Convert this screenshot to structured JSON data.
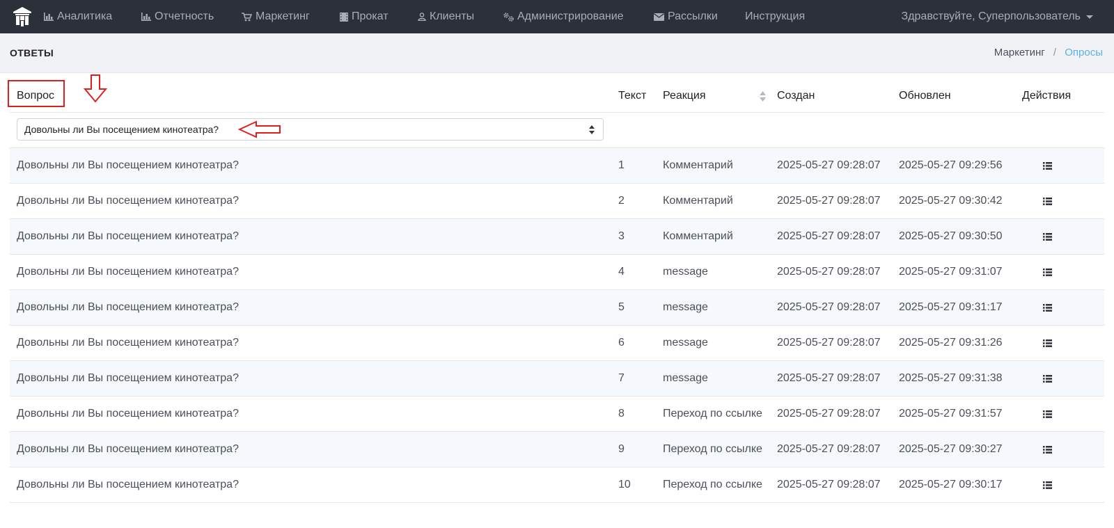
{
  "navbar": {
    "items": [
      {
        "label": "Аналитика",
        "icon": "bar-chart-icon"
      },
      {
        "label": "Отчетность",
        "icon": "bar-chart-icon"
      },
      {
        "label": "Маркетинг",
        "icon": "cart-icon"
      },
      {
        "label": "Прокат",
        "icon": "film-icon"
      },
      {
        "label": "Клиенты",
        "icon": "user-icon"
      },
      {
        "label": "Администрирование",
        "icon": "cogs-icon"
      },
      {
        "label": "Рассылки",
        "icon": "envelope-icon"
      },
      {
        "label": "Инструкция",
        "icon": ""
      }
    ],
    "user_greeting": "Здравствуйте, Суперпользователь"
  },
  "header": {
    "title": "ОТВЕТЫ",
    "breadcrumb": {
      "parent": "Маркетинг",
      "separator": "/",
      "current": "Опросы"
    }
  },
  "table": {
    "columns": {
      "question": "Вопрос",
      "text": "Текст",
      "reaction": "Реакция",
      "created": "Создан",
      "updated": "Обновлен",
      "actions": "Действия"
    },
    "filter": {
      "question_selected": "Довольны ли Вы посещением кинотеатра?"
    },
    "rows": [
      {
        "question": "Довольны ли Вы посещением кинотеатра?",
        "text": "1",
        "reaction": "Комментарий",
        "created": "2025-05-27 09:28:07",
        "updated": "2025-05-27 09:29:56"
      },
      {
        "question": "Довольны ли Вы посещением кинотеатра?",
        "text": "2",
        "reaction": "Комментарий",
        "created": "2025-05-27 09:28:07",
        "updated": "2025-05-27 09:30:42"
      },
      {
        "question": "Довольны ли Вы посещением кинотеатра?",
        "text": "3",
        "reaction": "Комментарий",
        "created": "2025-05-27 09:28:07",
        "updated": "2025-05-27 09:30:50"
      },
      {
        "question": "Довольны ли Вы посещением кинотеатра?",
        "text": "4",
        "reaction": "message",
        "created": "2025-05-27 09:28:07",
        "updated": "2025-05-27 09:31:07"
      },
      {
        "question": "Довольны ли Вы посещением кинотеатра?",
        "text": "5",
        "reaction": "message",
        "created": "2025-05-27 09:28:07",
        "updated": "2025-05-27 09:31:17"
      },
      {
        "question": "Довольны ли Вы посещением кинотеатра?",
        "text": "6",
        "reaction": "message",
        "created": "2025-05-27 09:28:07",
        "updated": "2025-05-27 09:31:26"
      },
      {
        "question": "Довольны ли Вы посещением кинотеатра?",
        "text": "7",
        "reaction": "message",
        "created": "2025-05-27 09:28:07",
        "updated": "2025-05-27 09:31:38"
      },
      {
        "question": "Довольны ли Вы посещением кинотеатра?",
        "text": "8",
        "reaction": "Переход по ссылке",
        "created": "2025-05-27 09:28:07",
        "updated": "2025-05-27 09:31:57"
      },
      {
        "question": "Довольны ли Вы посещением кинотеатра?",
        "text": "9",
        "reaction": "Переход по ссылке",
        "created": "2025-05-27 09:28:07",
        "updated": "2025-05-27 09:30:27"
      },
      {
        "question": "Довольны ли Вы посещением кинотеатра?",
        "text": "10",
        "reaction": "Переход по ссылке",
        "created": "2025-05-27 09:28:07",
        "updated": "2025-05-27 09:30:17"
      }
    ],
    "row_action_icon": "list-icon"
  },
  "colors": {
    "navbar_bg": "#2c303b",
    "navbar_text": "#a9adb7",
    "subheader_bg": "#f1f2f6",
    "link": "#5ab0e6",
    "row_stripe": "#f5f8fc",
    "annotation": "#e01e1e"
  }
}
